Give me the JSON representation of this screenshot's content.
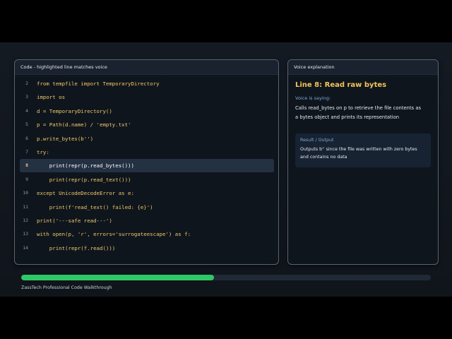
{
  "code_panel": {
    "title": "Code - highlighted line matches voice",
    "lines": [
      {
        "num": "2",
        "text": "from tempfile import TemporaryDirectory",
        "active": false
      },
      {
        "num": "3",
        "text": "import os",
        "active": false
      },
      {
        "num": "4",
        "text": "d = TemporaryDirectory()",
        "active": false
      },
      {
        "num": "5",
        "text": "p = Path(d.name) / 'empty.txt'",
        "active": false
      },
      {
        "num": "6",
        "text": "p.write_bytes(b'')",
        "active": false
      },
      {
        "num": "7",
        "text": "try:",
        "active": false
      },
      {
        "num": "8",
        "text": "    print(repr(p.read_bytes()))",
        "active": true
      },
      {
        "num": "9",
        "text": "    print(repr(p.read_text()))",
        "active": false
      },
      {
        "num": "10",
        "text": "except UnicodeDecodeError as e:",
        "active": false
      },
      {
        "num": "11",
        "text": "    print(f'read_text() failed: {e}')",
        "active": false
      },
      {
        "num": "12",
        "text": "print('---safe read---')",
        "active": false
      },
      {
        "num": "13",
        "text": "with open(p, 'r', errors='surrogateescape') as f:",
        "active": false
      },
      {
        "num": "14",
        "text": "    print(repr(f.read()))",
        "active": false
      }
    ]
  },
  "voice_panel": {
    "title": "Voice explanation",
    "heading": "Line 8: Read raw bytes",
    "saying_label": "Voice is saying:",
    "saying_text": "Calls read_bytes on p to retrieve the file contents as a bytes object and prints its representation",
    "result_label": "Result / Output",
    "result_text": "Outputs b'' since the file was written with zero bytes and contains no data"
  },
  "progress": {
    "fraction": 0.47
  },
  "footer": {
    "text": "ZassTech Professional Code Walkthrough"
  },
  "colors": {
    "accent": "#f2c45a",
    "progress": "#2ec866",
    "highlight_row": "#243143"
  }
}
